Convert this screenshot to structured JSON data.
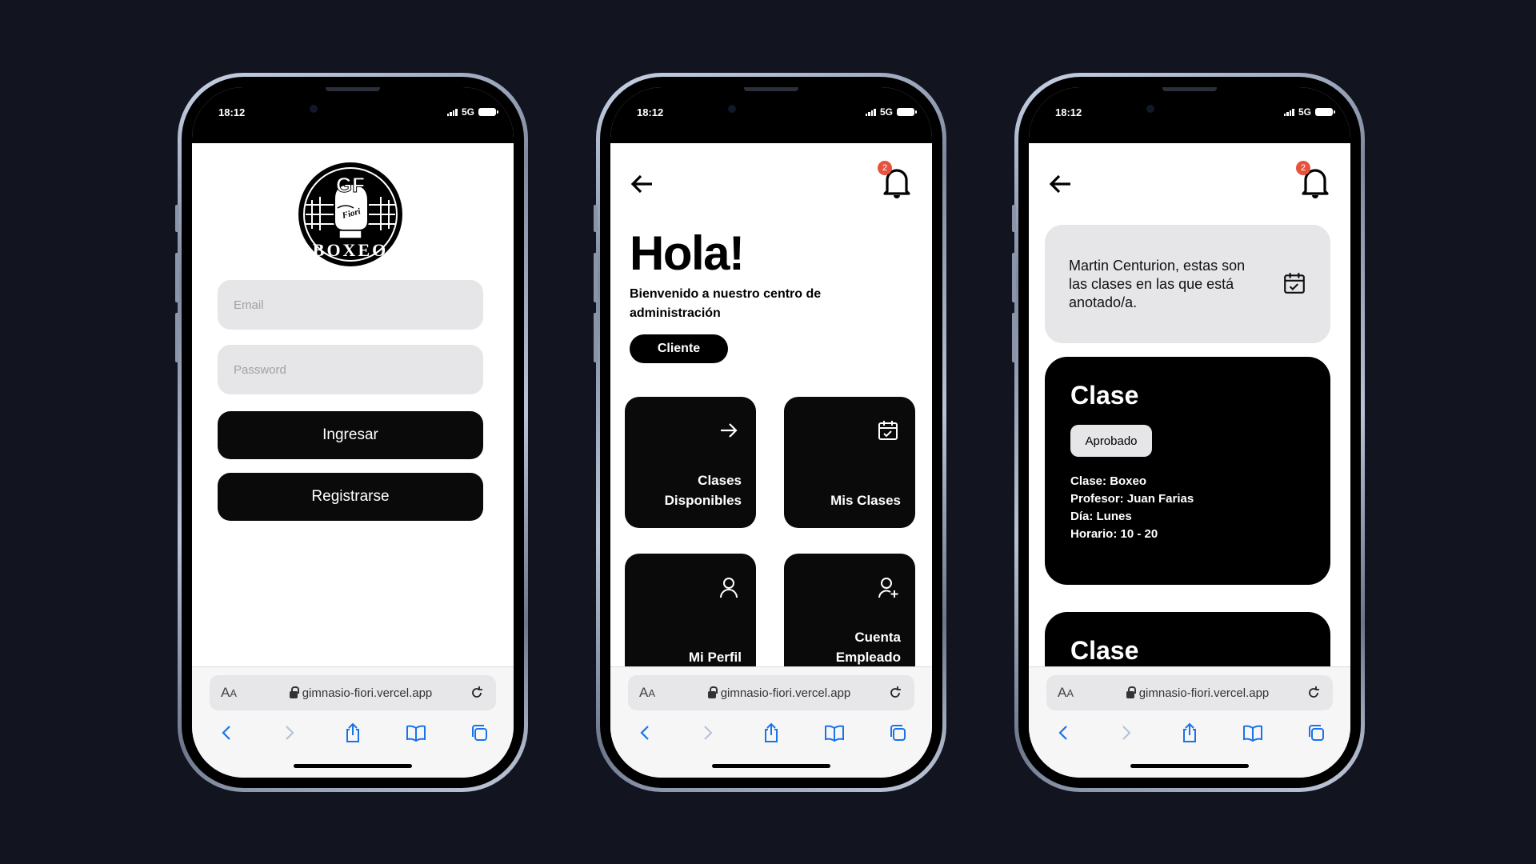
{
  "status": {
    "time": "18:12",
    "network": "5G"
  },
  "browser": {
    "aa_big": "A",
    "aa_small": "A",
    "url": "gimnasio-fiori.vercel.app"
  },
  "login": {
    "logo_text_top": "GF",
    "logo_text_mid": "Fiori",
    "logo_text_bottom": "BOXEO",
    "email_placeholder": "Email",
    "password_placeholder": "Password",
    "login_button": "Ingresar",
    "register_button": "Registrarse"
  },
  "dashboard": {
    "badge_count": "2",
    "title": "Hola!",
    "subtitle": "Bienvenido a nuestro centro de administración",
    "role_pill": "Cliente",
    "tiles": [
      {
        "line1": "Clases",
        "line2": "Disponibles",
        "icon": "arrow-right-icon"
      },
      {
        "line1": "",
        "line2": "Mis Clases",
        "icon": "calendar-check-icon"
      },
      {
        "line1": "",
        "line2": "Mi Perfil",
        "icon": "user-icon"
      },
      {
        "line1": "Cuenta",
        "line2": "Empleado",
        "icon": "user-plus-icon"
      }
    ]
  },
  "my_classes": {
    "badge_count": "2",
    "info_text": "Martin Centurion, estas son las clases en las que está anotado/a.",
    "cards": [
      {
        "title": "Clase",
        "status": "Aprobado",
        "clase": "Clase: Boxeo",
        "profesor": "Profesor: Juan Farias",
        "dia": "Día: Lunes",
        "horario": "Horario: 10 - 20"
      },
      {
        "title": "Clase"
      }
    ]
  },
  "colors": {
    "background": "#12151f",
    "badge": "#e5533d",
    "browser_blue": "#1a73e8"
  }
}
